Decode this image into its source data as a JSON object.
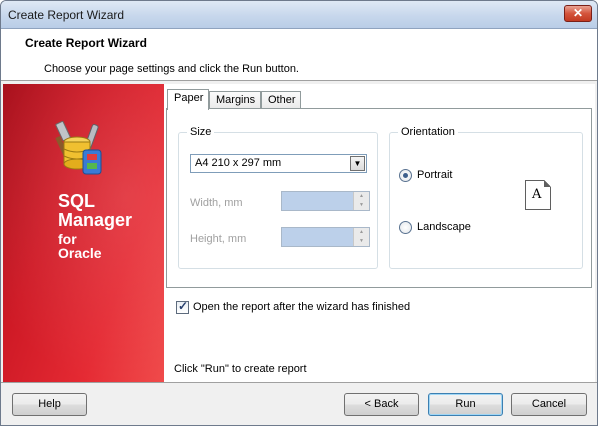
{
  "window": {
    "title": "Create Report Wizard",
    "close_glyph": "✕"
  },
  "header": {
    "title": "Create Report Wizard",
    "subtitle": "Choose your page settings and click the Run button."
  },
  "banner": {
    "logo_icon": "database-tools-icon",
    "product_line1": "SQL",
    "product_line2": "Manager",
    "product_line3": "for",
    "product_line4": "Oracle",
    "color": "#d91f2a"
  },
  "tabs": [
    {
      "label": "Paper",
      "active": true
    },
    {
      "label": "Margins",
      "active": false
    },
    {
      "label": "Other",
      "active": false
    }
  ],
  "size_group": {
    "legend": "Size",
    "paper_size_value": "A4 210 x 297 mm",
    "width_label": "Width, mm",
    "height_label": "Height, mm",
    "width_value": "",
    "height_value": ""
  },
  "orientation_group": {
    "legend": "Orientation",
    "portrait_label": "Portrait",
    "landscape_label": "Landscape",
    "selected": "Portrait",
    "preview_icon": "portrait-page-icon",
    "preview_letter": "A"
  },
  "open_after": {
    "label": "Open the report after the wizard has finished",
    "checked": true
  },
  "hint": "Click \"Run\" to create report",
  "buttons": {
    "help": "Help",
    "back": "< Back",
    "run": "Run",
    "cancel": "Cancel"
  }
}
